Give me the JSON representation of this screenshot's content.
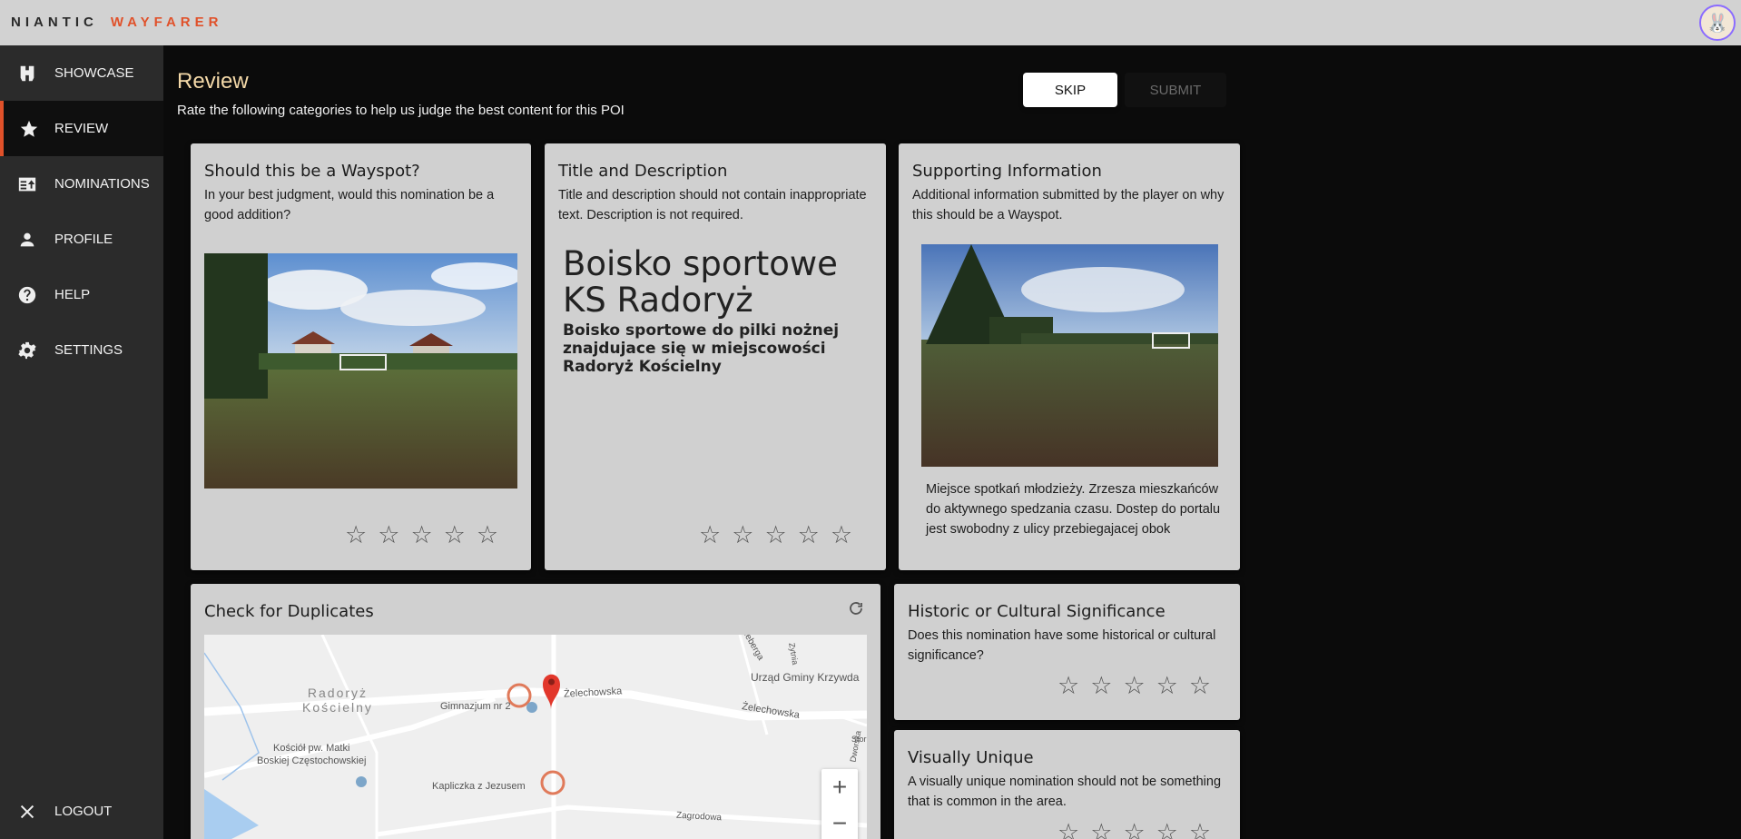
{
  "app": {
    "brand_left": "NIANTIC",
    "brand_right": "WAYFARER",
    "accent": "#e0512a"
  },
  "sidebar": {
    "items": [
      {
        "label": "SHOWCASE",
        "icon": "binoculars-icon"
      },
      {
        "label": "REVIEW",
        "icon": "star-icon",
        "active": true
      },
      {
        "label": "NOMINATIONS",
        "icon": "nominations-icon"
      },
      {
        "label": "PROFILE",
        "icon": "person-icon"
      },
      {
        "label": "HELP",
        "icon": "help-icon"
      },
      {
        "label": "SETTINGS",
        "icon": "gear-icon"
      }
    ],
    "logout_label": "LOGOUT"
  },
  "header": {
    "title": "Review",
    "subtitle": "Rate the following categories to help us judge the best content for this POI",
    "skip_label": "SKIP",
    "submit_label": "SUBMIT"
  },
  "cards": {
    "wayspot": {
      "title": "Should this be a Wayspot?",
      "desc": "In your best judgment, would this nomination be a good addition?"
    },
    "title_desc": {
      "title": "Title and Description",
      "desc": "Title and description should not contain inappropriate text. Description is not required.",
      "poi_title": "Boisko sportowe KS Radoryż",
      "poi_description": "Boisko sportowe do pilki nożnej znajdujace się w miejscowości Radoryż Kościelny"
    },
    "supporting": {
      "title": "Supporting Information",
      "desc": "Additional information submitted by the player on why this should be a Wayspot.",
      "text": "Miejsce spotkań młodzieży. Zrzesza mieszkańców do aktywnego spedzania czasu. Dostep do portalu jest swobodny z ulicy przebiegajacej obok"
    },
    "duplicates": {
      "title": "Check for Duplicates",
      "map_labels": {
        "village": "Radoryż\nKościelny",
        "school": "Gimnazjum nr 2",
        "street1": "Żelechowska",
        "street2": "Żelechowska",
        "office": "Urząd Gminy Krzywda",
        "church": "Kościół pw. Matki\nBoskiej Częstochowskiej",
        "chapel": "Kapliczka z Jezusem",
        "street3": "Zagrodowa",
        "street4": "Zytnia",
        "street5": "Dworska",
        "street6": "eeberga",
        "street7": "Stor"
      },
      "zoom_in": "+",
      "zoom_out": "−"
    },
    "historic": {
      "title": "Historic or Cultural Significance",
      "desc": "Does this nomination have some historical or cultural significance?"
    },
    "unique": {
      "title": "Visually Unique",
      "desc": "A visually unique nomination should not be something that is common in the area."
    }
  },
  "star_glyph": "☆"
}
